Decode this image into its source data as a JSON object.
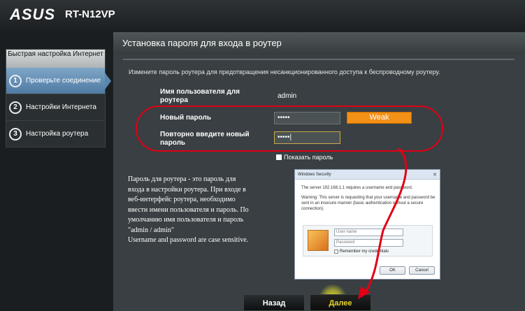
{
  "header": {
    "logo": "ASUS",
    "model": "RT-N12VP"
  },
  "sidebar": {
    "title": "Быстрая настройка Интернет",
    "items": [
      {
        "number": "1",
        "label": "Проверьте соединение"
      },
      {
        "number": "2",
        "label": "Настройки Интернета"
      },
      {
        "number": "3",
        "label": "Настройка роутера"
      }
    ]
  },
  "panel": {
    "title": "Установка пароля для входа в роутер",
    "description": "Измените пароль роутера для предотвращения несанкционированного доступа к беспроводному роутеру.",
    "username_label": "Имя пользователя для роутера",
    "username_value": "admin",
    "password_label": "Новый пароль",
    "password_value": "•••••",
    "strength": "Weak",
    "confirm_label": "Повторно введите новый пароль",
    "confirm_value": "•••••|",
    "show_password": "Показать пароль",
    "info_lines": [
      "Пароль для роутера - это пароль для",
      "входа в настройки роутера. При входе в",
      "веб-интерфейс роутера, необходимо",
      "ввести имени пользователя и пароль. По",
      "умолчанию имя пользователя и пароль",
      "\"admin / admin\"",
      "Username and password are case sensitive."
    ]
  },
  "windows_dialog": {
    "title": "Windows Security",
    "line1": "The server 192.168.1.1  requires a username and password.",
    "warning_lines": [
      "Warning: This server is requesting that your username and password be",
      "sent in an insecure manner (basic authentication without a secure",
      "connection)."
    ],
    "user_placeholder": "User name",
    "pass_placeholder": "Password",
    "remember": "Remember my credentials",
    "ok": "OK",
    "cancel": "Cancel"
  },
  "buttons": {
    "back": "Назад",
    "next": "Далее"
  },
  "colors": {
    "annotation": "#e10016",
    "strength_weak": "#f39016",
    "next_text": "#e7d42a",
    "sidebar_active": "#5b86ad"
  }
}
